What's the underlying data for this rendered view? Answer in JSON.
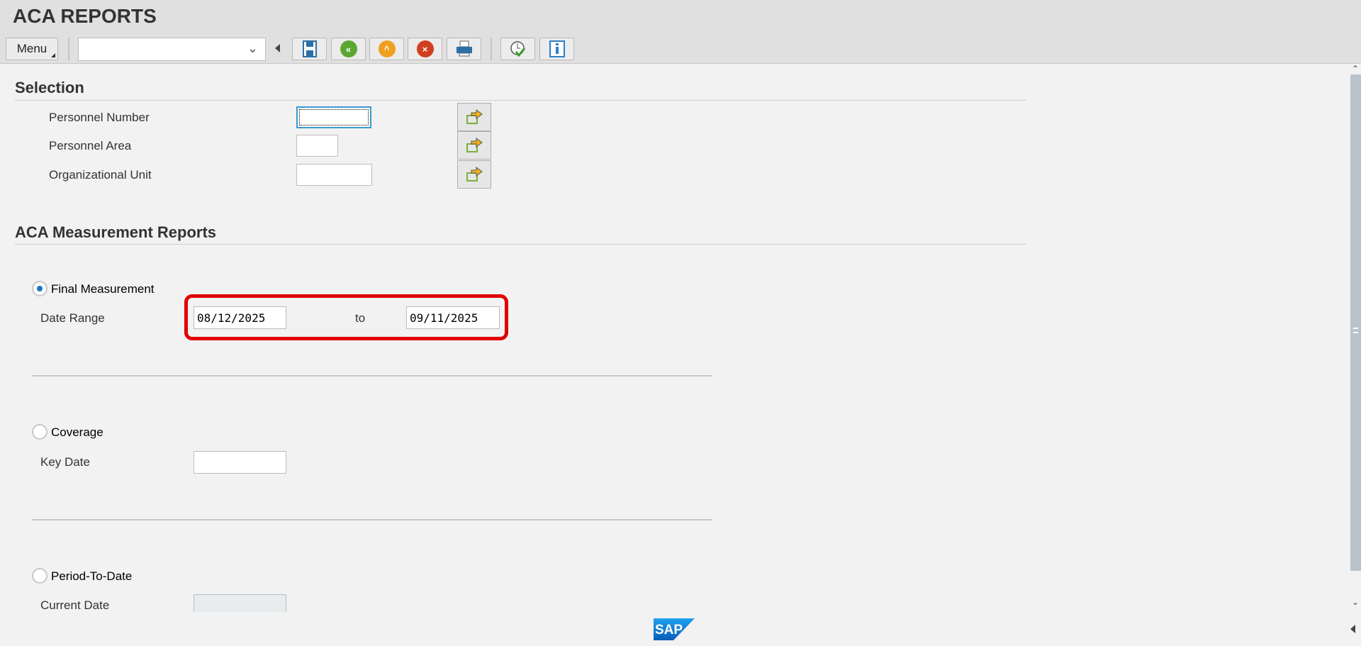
{
  "app": {
    "title": "ACA REPORTS"
  },
  "toolbar": {
    "menu_label": "Menu",
    "command_field": "",
    "buttons": [
      {
        "name": "save",
        "icon": "save-icon"
      },
      {
        "name": "back",
        "icon": "back-icon"
      },
      {
        "name": "exit",
        "icon": "exit-icon"
      },
      {
        "name": "cancel",
        "icon": "cancel-icon"
      },
      {
        "name": "print",
        "icon": "print-icon"
      },
      {
        "name": "execute",
        "icon": "execute-icon"
      },
      {
        "name": "info",
        "icon": "info-icon"
      }
    ]
  },
  "selection": {
    "title": "Selection",
    "fields": [
      {
        "label": "Personnel Number",
        "value": ""
      },
      {
        "label": "Personnel Area",
        "value": ""
      },
      {
        "label": "Organizational Unit",
        "value": ""
      }
    ]
  },
  "aca": {
    "title": "ACA Measurement Reports",
    "final": {
      "label": "Final Measurement",
      "selected": true,
      "range_label": "Date Range",
      "from": "08/12/2025",
      "to_label": "to",
      "to": "09/11/2025"
    },
    "coverage": {
      "label": "Coverage",
      "selected": false,
      "key_date_label": "Key Date",
      "key_date": ""
    },
    "ptd": {
      "label": "Period-To-Date",
      "selected": false,
      "current_date_label": "Current Date",
      "current_date": ""
    }
  },
  "footer": {
    "logo": "SAP"
  },
  "colors": {
    "highlight": "#e00000",
    "accent": "#1a73c8"
  }
}
